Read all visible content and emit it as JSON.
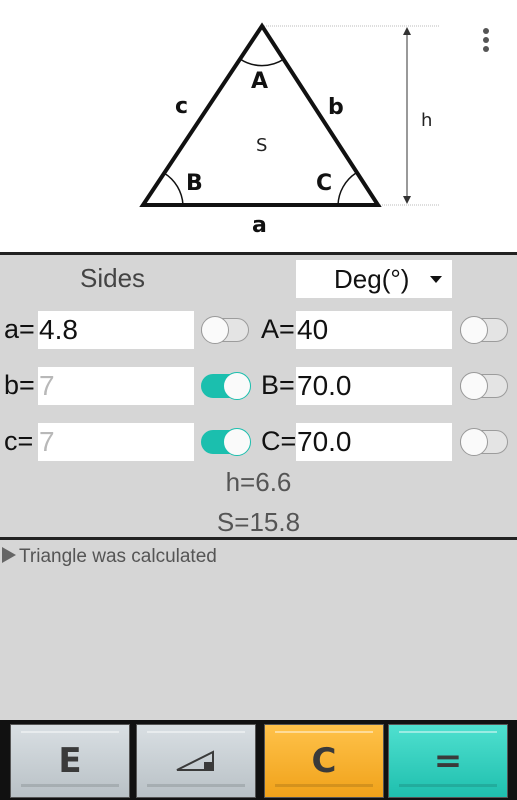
{
  "diagram": {
    "vertex_labels": {
      "A": "A",
      "B": "B",
      "C": "C"
    },
    "side_labels": {
      "a": "a",
      "b": "b",
      "c": "c"
    },
    "area_label": "S",
    "height_label": "h"
  },
  "panel": {
    "sides_title": "Sides",
    "unit_select": "Deg(°)",
    "rows": [
      {
        "side_label": "a=",
        "side_value": "4.8",
        "side_placeholder": "",
        "side_toggle": false,
        "angle_label": "A=",
        "angle_value": "40",
        "angle_toggle": false
      },
      {
        "side_label": "b=",
        "side_value": "",
        "side_placeholder": "7",
        "side_toggle": true,
        "angle_label": "B=",
        "angle_value": "70.0",
        "angle_toggle": false
      },
      {
        "side_label": "c=",
        "side_value": "",
        "side_placeholder": "7",
        "side_toggle": true,
        "angle_label": "C=",
        "angle_value": "70.0",
        "angle_toggle": false
      }
    ],
    "height_result": "h=6.6",
    "area_result": "S=15.8"
  },
  "status": {
    "message": "Triangle was calculated"
  },
  "keypad": {
    "e_label": "E",
    "c_label": "C",
    "eq_label": "="
  },
  "colors": {
    "toggle_on": "#1bbfae",
    "key_orange": "#f0a21a",
    "key_teal": "#1fbfae",
    "panel_bg": "#d6d6d6"
  }
}
